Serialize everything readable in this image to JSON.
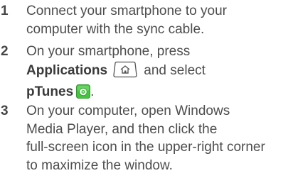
{
  "steps": [
    {
      "number": "1",
      "lines": [
        "Connect your smartphone to your",
        "computer with the sync cable."
      ]
    },
    {
      "number": "2",
      "line1": "On your smartphone, press",
      "applications": "Applications",
      "and_select": "and select",
      "ptunes": "pTunes",
      "period": "."
    },
    {
      "number": "3",
      "lines": [
        "On your computer, open Windows",
        "Media Player, and then click the",
        "full-screen icon in the upper-right corner",
        "to maximize the window."
      ]
    }
  ],
  "icons": {
    "applications_key": "home-key-icon",
    "ptunes": "ptunes-app-icon"
  },
  "colors": {
    "text": "#4d4d4d",
    "ptunes_green": "#3fbf3a"
  }
}
